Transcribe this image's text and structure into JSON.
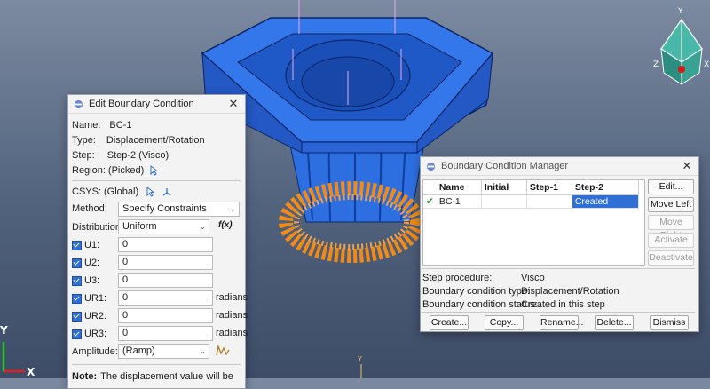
{
  "viewport": {
    "triad_top": {
      "x": "X",
      "y": "Y",
      "z": "Z"
    },
    "triad_bottom": {
      "x": "X",
      "y": "Y"
    },
    "center_marker": "Y"
  },
  "edit_bc": {
    "title": "Edit Boundary Condition",
    "name_label": "Name:",
    "name_value": "BC-1",
    "type_label": "Type:",
    "type_value": "Displacement/Rotation",
    "step_label": "Step:",
    "step_value": "Step-2 (Visco)",
    "region_label": "Region:",
    "region_value": "(Picked)",
    "csys_label": "CSYS:",
    "csys_value": "(Global)",
    "method_label": "Method:",
    "method_value": "Specify Constraints",
    "distribution_label": "Distribution:",
    "distribution_value": "Uniform",
    "fx_label": "f(x)",
    "fields": [
      {
        "label": "U1:",
        "value": "0",
        "unit": ""
      },
      {
        "label": "U2:",
        "value": "0",
        "unit": ""
      },
      {
        "label": "U3:",
        "value": "0",
        "unit": ""
      },
      {
        "label": "UR1:",
        "value": "0",
        "unit": "radians"
      },
      {
        "label": "UR2:",
        "value": "0",
        "unit": "radians"
      },
      {
        "label": "UR3:",
        "value": "0",
        "unit": "radians"
      }
    ],
    "amplitude_label": "Amplitude:",
    "amplitude_value": "(Ramp)",
    "note_label": "Note:",
    "note_text": "The displacement value will be"
  },
  "bc_manager": {
    "title": "Boundary Condition Manager",
    "columns": [
      "Name",
      "Initial",
      "Step-1",
      "Step-2"
    ],
    "rows": [
      {
        "check": "✔",
        "name": "BC-1",
        "initial": "",
        "step1": "",
        "step2": "Created"
      }
    ],
    "side_buttons": [
      {
        "label": "Edit...",
        "enabled": true
      },
      {
        "label": "Move Left",
        "enabled": true
      },
      {
        "label": "Move Right",
        "enabled": false
      },
      {
        "label": "Activate",
        "enabled": false
      },
      {
        "label": "Deactivate",
        "enabled": false
      }
    ],
    "step_procedure_label": "Step procedure:",
    "step_procedure_value": "Visco",
    "bc_type_label": "Boundary condition type:",
    "bc_type_value": "Displacement/Rotation",
    "bc_status_label": "Boundary condition status:",
    "bc_status_value": "Created in this step",
    "bottom_buttons": [
      "Create...",
      "Copy...",
      "Rename...",
      "Delete...",
      "Dismiss"
    ]
  }
}
